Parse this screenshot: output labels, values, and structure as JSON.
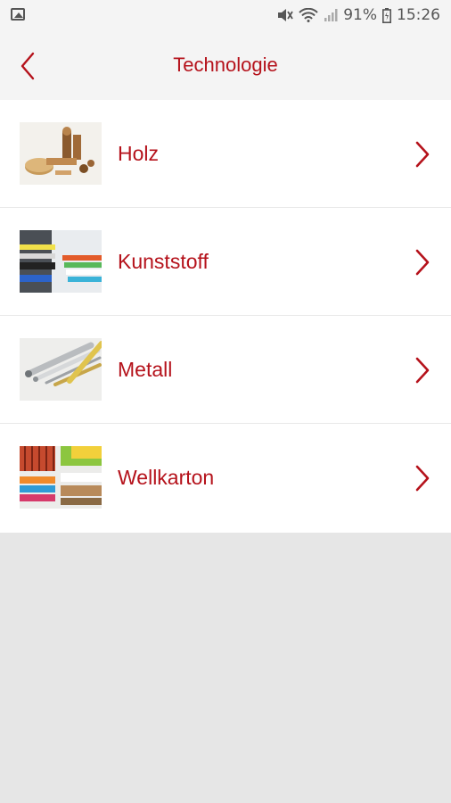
{
  "statusbar": {
    "battery": "91%",
    "time": "15:26",
    "icons": [
      "image-icon",
      "mute-icon",
      "wifi-icon",
      "signal-icon",
      "battery-icon"
    ]
  },
  "header": {
    "title": "Technologie",
    "back_icon": "chevron-left-icon"
  },
  "list": {
    "items": [
      {
        "label": "Holz",
        "thumb": "wood-thumbnail"
      },
      {
        "label": "Kunststoff",
        "thumb": "plastic-thumbnail"
      },
      {
        "label": "Metall",
        "thumb": "metal-thumbnail"
      },
      {
        "label": "Wellkarton",
        "thumb": "corrugated-cardboard-thumbnail"
      }
    ]
  },
  "colors": {
    "accent": "#b5121b",
    "header_bg": "#f4f4f4",
    "list_bg": "#ffffff",
    "page_bg": "#e6e6e6"
  }
}
